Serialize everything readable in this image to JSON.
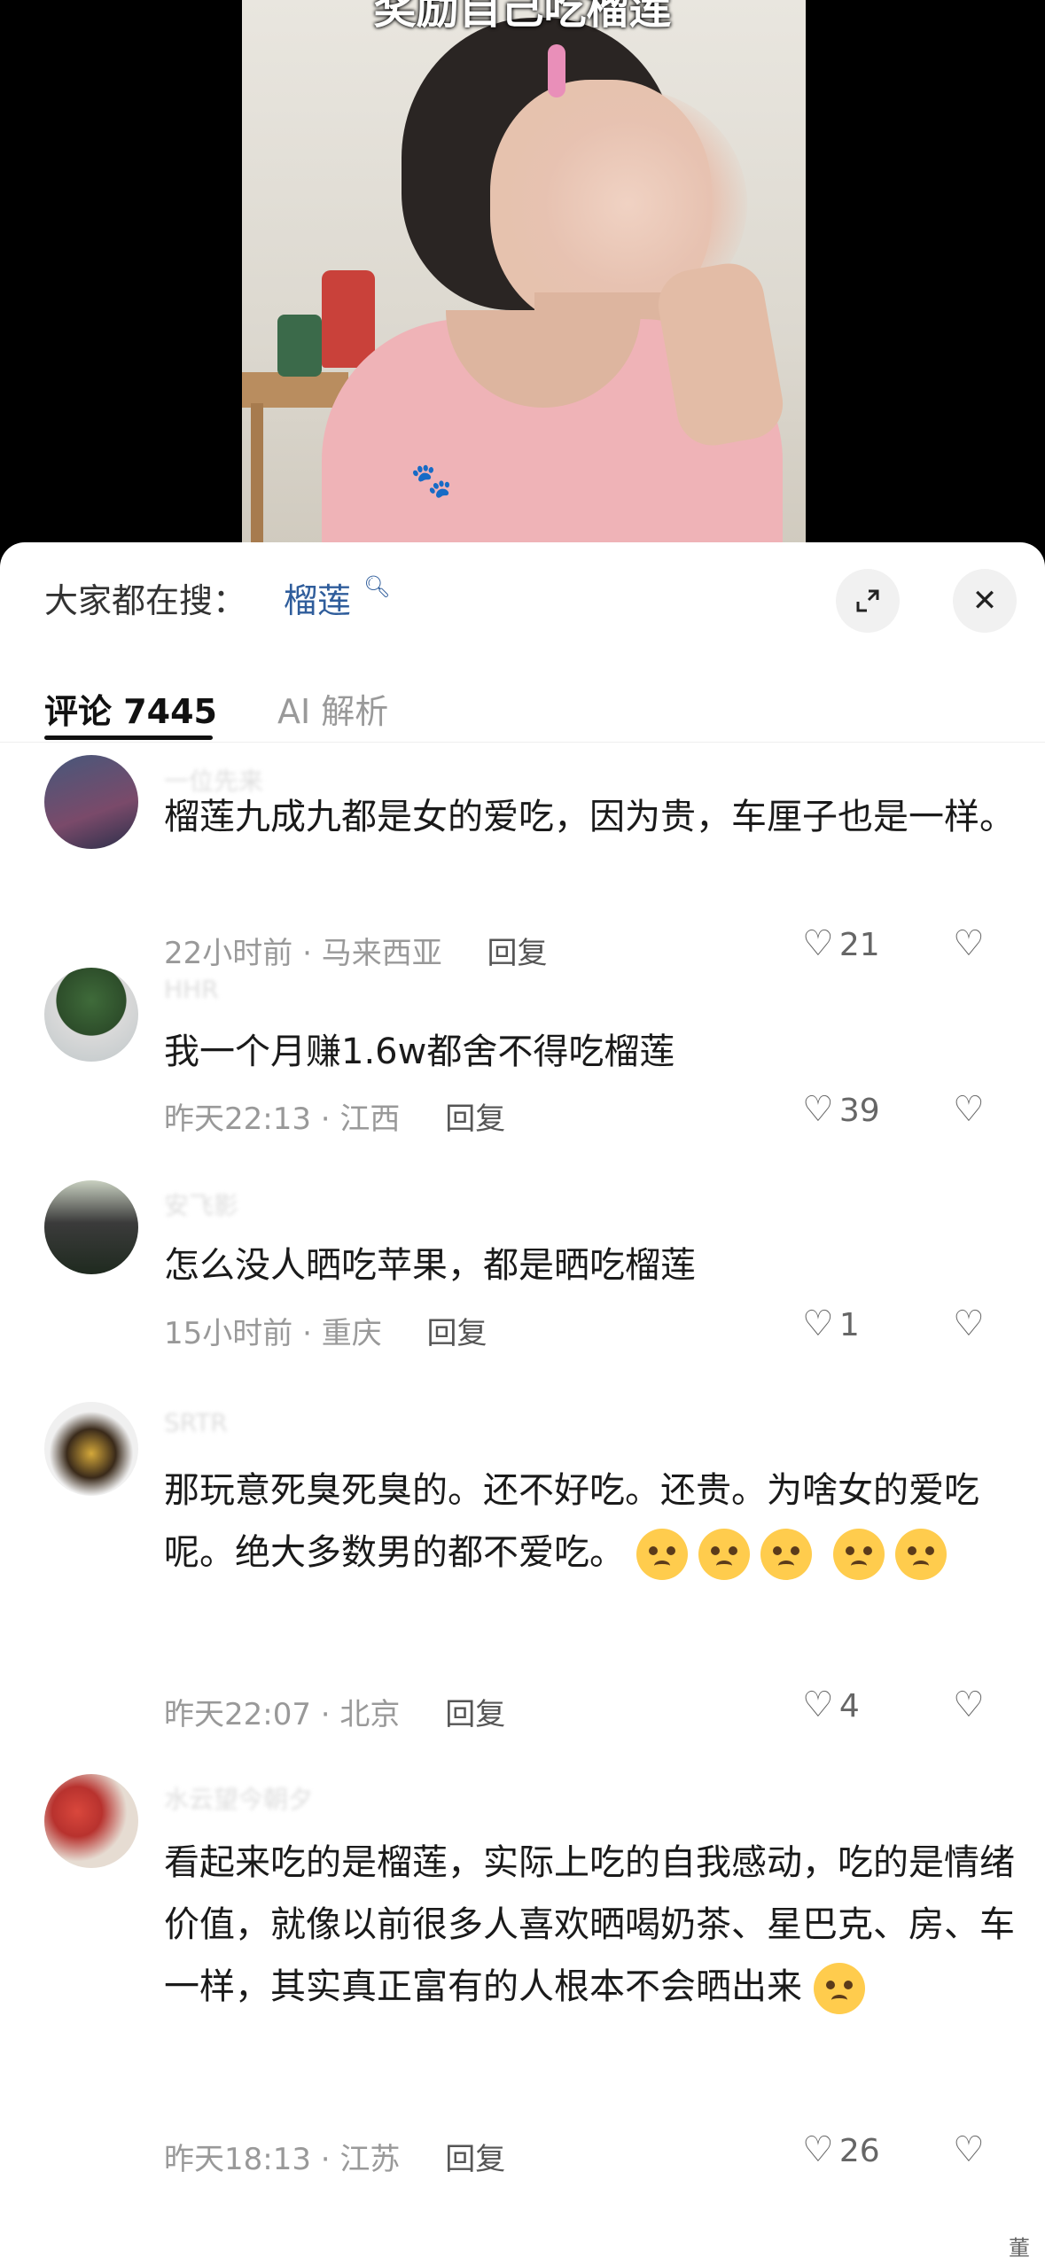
{
  "video": {
    "caption": "奖励自己吃榴莲"
  },
  "search": {
    "prefix": "大家都在搜：",
    "term": "榴莲"
  },
  "tabs": {
    "comments": "评论 7445",
    "ai": "AI 解析"
  },
  "comments": [
    {
      "username": "一位先来",
      "text": "榴莲九成九都是女的爱吃，因为贵，车厘子也是一样。",
      "time": "22小时前",
      "location": "马来西亚",
      "reply": "回复",
      "likes": "21"
    },
    {
      "username": "HHR",
      "text": "我一个月赚1.6w都舍不得吃榴莲",
      "time": "昨天22:13",
      "location": "江西",
      "reply": "回复",
      "likes": "39"
    },
    {
      "username": "安飞影",
      "text": "怎么没人晒吃苹果，都是晒吃榴莲",
      "time": "15小时前",
      "location": "重庆",
      "reply": "回复",
      "likes": "1"
    },
    {
      "username": "SRTR",
      "text": "那玩意死臭死臭的。还不好吃。还贵。为啥女的爱吃呢。绝大多数男的都不爱吃。",
      "time": "昨天22:07",
      "location": "北京",
      "reply": "回复",
      "likes": "4"
    },
    {
      "username": "水云望今朝夕",
      "text": "看起来吃的是榴莲，实际上吃的自我感动，吃的是情绪价值，就像以前很多人喜欢晒喝奶茶、星巴克、房、车一样，其实真正富有的人根本不会晒出来",
      "time": "昨天18:13",
      "location": "江苏",
      "reply": "回复",
      "likes": "26"
    }
  ],
  "icons": {
    "heart": "heart-icon",
    "dislike": "broken-heart-icon",
    "expand": "expand-icon",
    "close": "close-icon"
  },
  "watermark": "董"
}
